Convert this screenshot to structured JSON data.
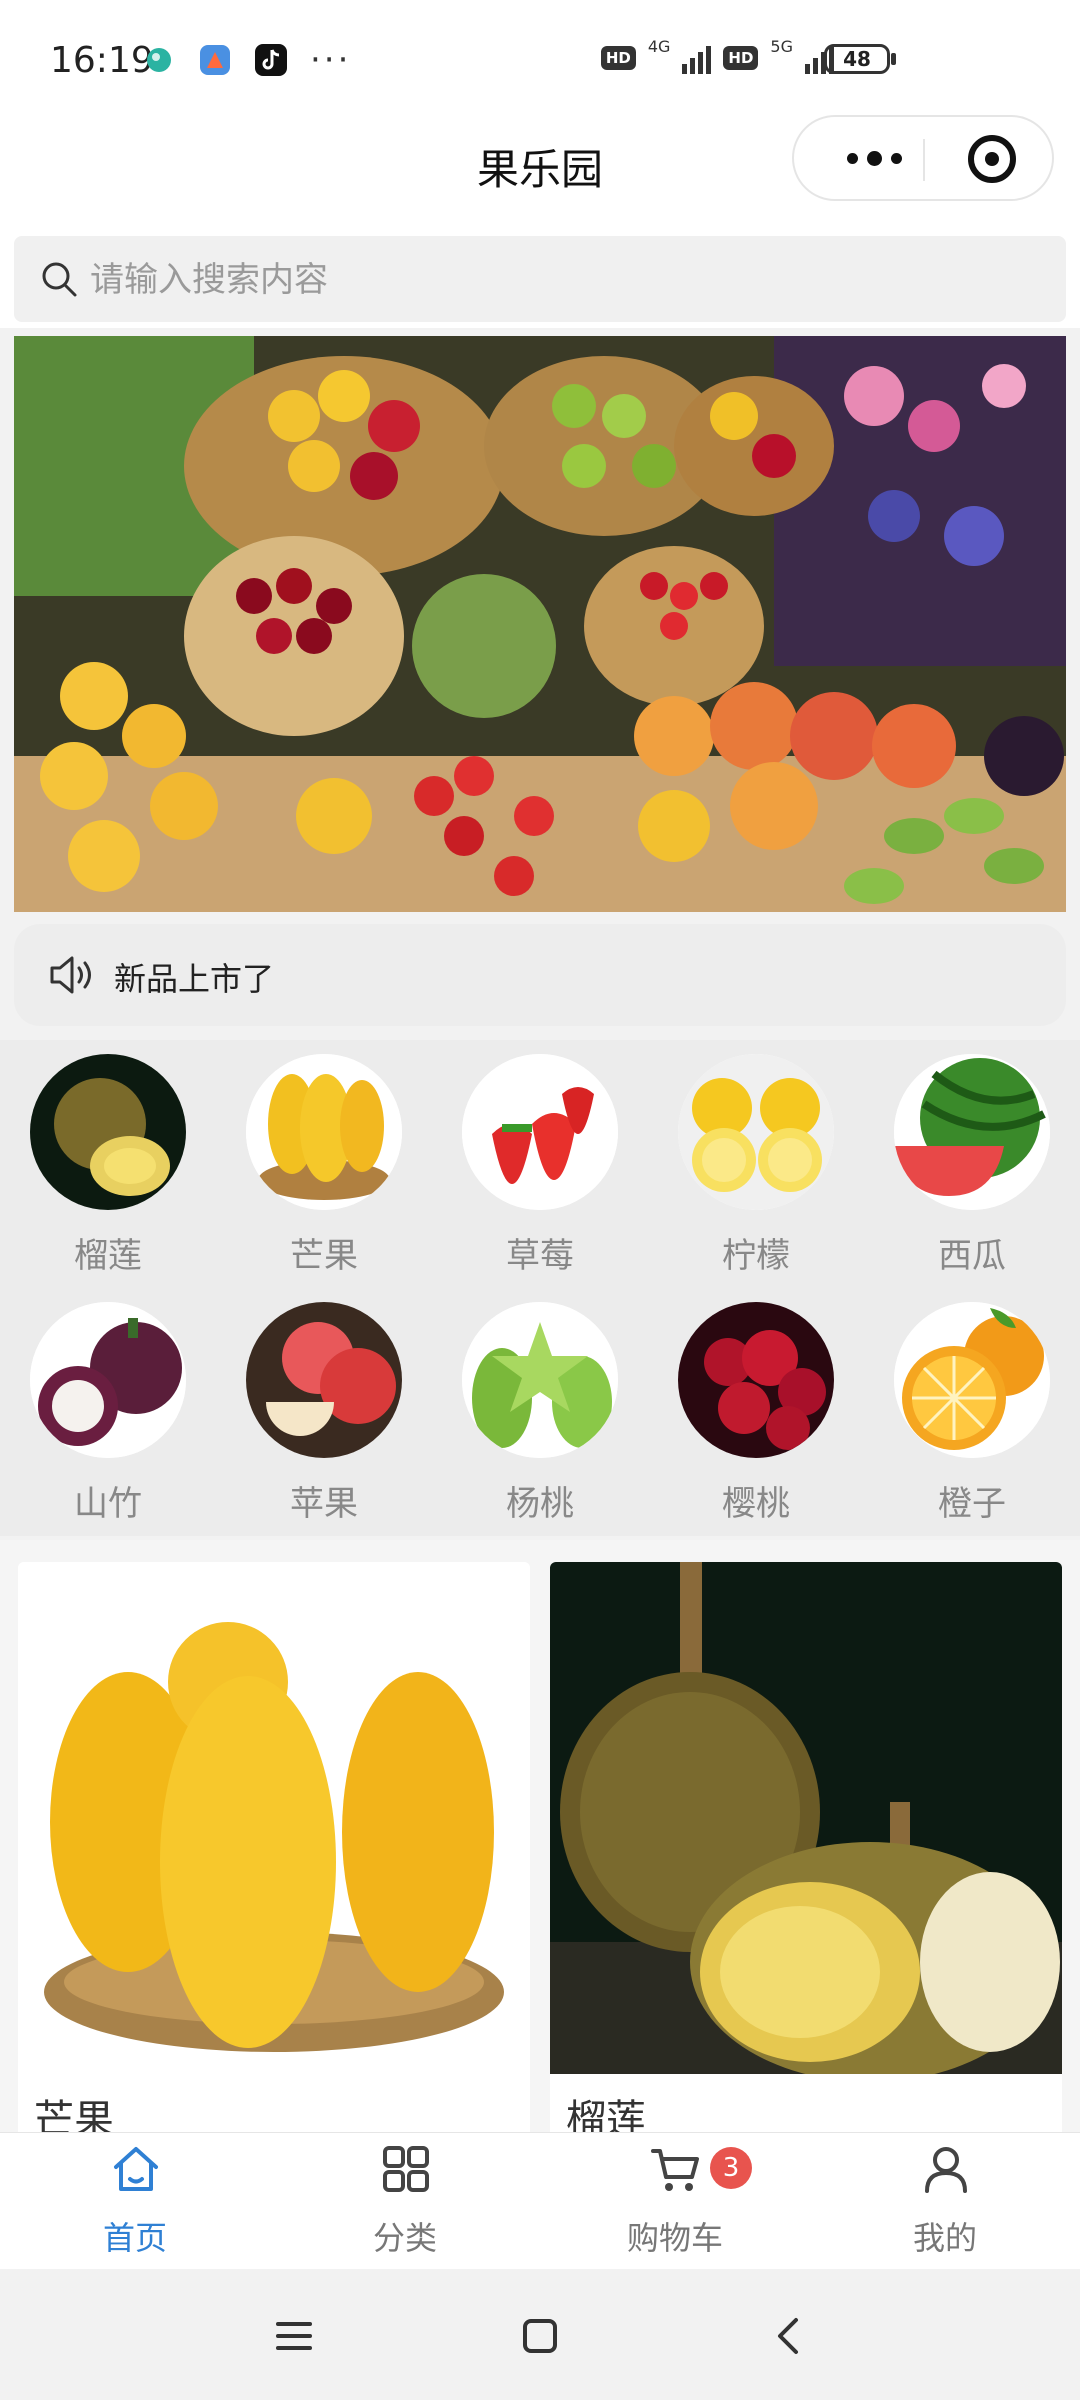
{
  "status_bar": {
    "time": "16:19",
    "more": "···",
    "hd1": "HD",
    "net1": "4G",
    "hd2": "HD",
    "net2": "5G",
    "battery": "48"
  },
  "nav": {
    "title": "果乐园"
  },
  "search": {
    "placeholder": "请输入搜索内容"
  },
  "notice": {
    "text": "新品上市了"
  },
  "categories": [
    {
      "label": "榴莲"
    },
    {
      "label": "芒果"
    },
    {
      "label": "草莓"
    },
    {
      "label": "柠檬"
    },
    {
      "label": "西瓜"
    },
    {
      "label": "山竹"
    },
    {
      "label": "苹果"
    },
    {
      "label": "杨桃"
    },
    {
      "label": "樱桃"
    },
    {
      "label": "橙子"
    }
  ],
  "products": [
    {
      "name": "芒果"
    },
    {
      "name": "榴莲"
    }
  ],
  "tab_bar": {
    "tabs": [
      {
        "label": "首页",
        "icon": "home-icon",
        "active": true
      },
      {
        "label": "分类",
        "icon": "grid-icon"
      },
      {
        "label": "购物车",
        "icon": "cart-icon",
        "badge": "3"
      },
      {
        "label": "我的",
        "icon": "user-icon"
      }
    ],
    "active_color": "#2f80d4",
    "badge_color": "#e8544e"
  },
  "system_nav": {
    "icons": [
      "menu-icon",
      "home-square-icon",
      "back-icon"
    ]
  }
}
